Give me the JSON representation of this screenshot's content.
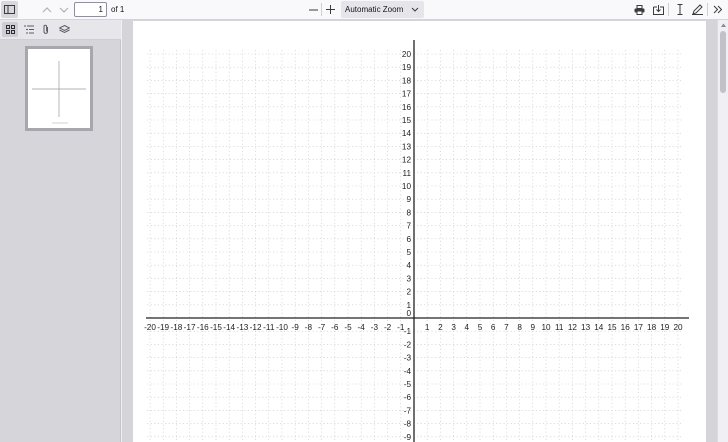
{
  "toolbar": {
    "sidebar_toggle_icon": "sidebar-toggle-icon",
    "prev_icon": "chevron-up-icon",
    "next_icon": "chevron-down-icon",
    "page_number": "1",
    "page_count": "of 1",
    "zoom_out_label": "—",
    "zoom_in_label": "+",
    "zoom_value": "Automatic Zoom",
    "print_icon": "print-icon",
    "download_icon": "download-icon",
    "text_tool_icon": "text-cursor-icon",
    "draw_tool_icon": "pen-icon",
    "more_icon": "double-chevron-right-icon"
  },
  "sidebar": {
    "buttons": [
      "thumbnail-view-icon",
      "outline-icon",
      "attachment-icon",
      "layers-icon"
    ]
  },
  "graph": {
    "x_range": [
      -20,
      20
    ],
    "y_visible_range": [
      -9,
      20
    ],
    "grid": "dotted"
  }
}
